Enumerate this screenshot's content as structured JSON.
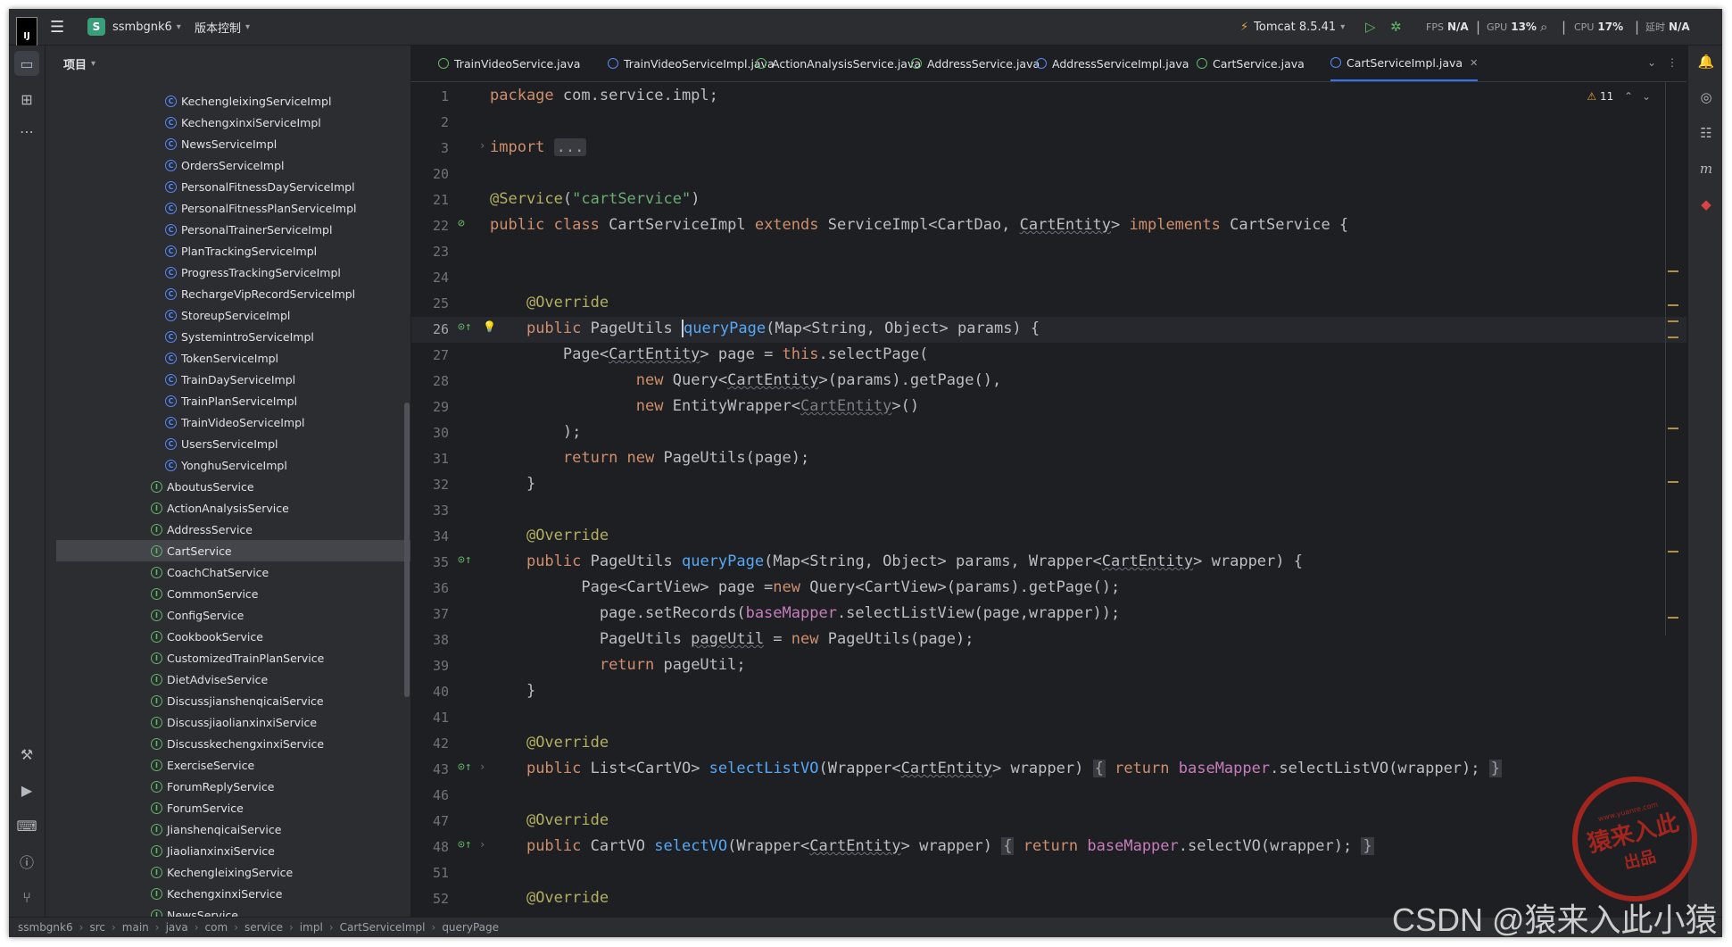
{
  "titlebar": {
    "project_badge": "S",
    "project_name": "ssmbgnk6",
    "vcs_label": "版本控制",
    "run_config": "Tomcat 8.5.41",
    "fps_label": "FPS",
    "fps_value": "N/A",
    "gpu_label": "GPU",
    "gpu_value": "13%",
    "cpu_label": "CPU",
    "cpu_value": "17%",
    "time_label": "延时",
    "time_value": "N/A"
  },
  "project_panel": {
    "title": "项目",
    "items": [
      {
        "label": "KechengleixingServiceImpl",
        "kind": "class"
      },
      {
        "label": "KechengxinxiServiceImpl",
        "kind": "class"
      },
      {
        "label": "NewsServiceImpl",
        "kind": "class"
      },
      {
        "label": "OrdersServiceImpl",
        "kind": "class"
      },
      {
        "label": "PersonalFitnessDayServiceImpl",
        "kind": "class"
      },
      {
        "label": "PersonalFitnessPlanServiceImpl",
        "kind": "class"
      },
      {
        "label": "PersonalTrainerServiceImpl",
        "kind": "class"
      },
      {
        "label": "PlanTrackingServiceImpl",
        "kind": "class"
      },
      {
        "label": "ProgressTrackingServiceImpl",
        "kind": "class"
      },
      {
        "label": "RechargeVipRecordServiceImpl",
        "kind": "class"
      },
      {
        "label": "StoreupServiceImpl",
        "kind": "class"
      },
      {
        "label": "SystemintroServiceImpl",
        "kind": "class"
      },
      {
        "label": "TokenServiceImpl",
        "kind": "class"
      },
      {
        "label": "TrainDayServiceImpl",
        "kind": "class"
      },
      {
        "label": "TrainPlanServiceImpl",
        "kind": "class"
      },
      {
        "label": "TrainVideoServiceImpl",
        "kind": "class"
      },
      {
        "label": "UsersServiceImpl",
        "kind": "class"
      },
      {
        "label": "YonghuServiceImpl",
        "kind": "class"
      },
      {
        "label": "AboutusService",
        "kind": "interface"
      },
      {
        "label": "ActionAnalysisService",
        "kind": "interface"
      },
      {
        "label": "AddressService",
        "kind": "interface"
      },
      {
        "label": "CartService",
        "kind": "interface",
        "selected": true
      },
      {
        "label": "CoachChatService",
        "kind": "interface"
      },
      {
        "label": "CommonService",
        "kind": "interface"
      },
      {
        "label": "ConfigService",
        "kind": "interface"
      },
      {
        "label": "CookbookService",
        "kind": "interface"
      },
      {
        "label": "CustomizedTrainPlanService",
        "kind": "interface"
      },
      {
        "label": "DietAdviseService",
        "kind": "interface"
      },
      {
        "label": "DiscussjianshenqicaiService",
        "kind": "interface"
      },
      {
        "label": "DiscussjiaolianxinxiService",
        "kind": "interface"
      },
      {
        "label": "DiscusskechengxinxiService",
        "kind": "interface"
      },
      {
        "label": "ExerciseService",
        "kind": "interface"
      },
      {
        "label": "ForumReplyService",
        "kind": "interface"
      },
      {
        "label": "ForumService",
        "kind": "interface"
      },
      {
        "label": "JianshenqicaiService",
        "kind": "interface"
      },
      {
        "label": "JiaolianxinxiService",
        "kind": "interface"
      },
      {
        "label": "KechengleixingService",
        "kind": "interface"
      },
      {
        "label": "KechengxinxiService",
        "kind": "interface"
      },
      {
        "label": "NewsService",
        "kind": "interface"
      }
    ]
  },
  "tabs": [
    {
      "label": "TrainVideoService.java",
      "kind": "interface"
    },
    {
      "label": "TrainVideoServiceImpl.java",
      "kind": "class"
    },
    {
      "label": "ActionAnalysisService.java",
      "kind": "interface"
    },
    {
      "label": "AddressService.java",
      "kind": "interface"
    },
    {
      "label": "AddressServiceImpl.java",
      "kind": "class"
    },
    {
      "label": "CartService.java",
      "kind": "interface"
    },
    {
      "label": "CartServiceImpl.java",
      "kind": "class",
      "active": true
    }
  ],
  "editor": {
    "inspection_count": "11",
    "line_numbers": [
      "1",
      "2",
      "3",
      "20",
      "21",
      "22",
      "23",
      "24",
      "25",
      "26",
      "27",
      "28",
      "29",
      "30",
      "31",
      "32",
      "33",
      "34",
      "35",
      "36",
      "37",
      "38",
      "39",
      "40",
      "41",
      "42",
      "43",
      "46",
      "47",
      "48",
      "51",
      "52"
    ],
    "current_line": "26"
  },
  "breadcrumb": [
    "ssmbgnk6",
    "src",
    "main",
    "java",
    "com",
    "service",
    "impl",
    "CartServiceImpl",
    "queryPage"
  ],
  "watermark": {
    "seal_top": "www.yuanre.com",
    "seal_main": "猿来入此",
    "seal_sub": "出品",
    "csdn": "CSDN @猿来入此小猿"
  },
  "colors": {
    "background": "#1e1f22",
    "panel": "#2b2d30",
    "keyword": "#cf8e6d",
    "string": "#6aab73",
    "annotation": "#b3ae60",
    "method": "#56a8f5",
    "field": "#c77dbb",
    "accent": "#3574f0"
  }
}
